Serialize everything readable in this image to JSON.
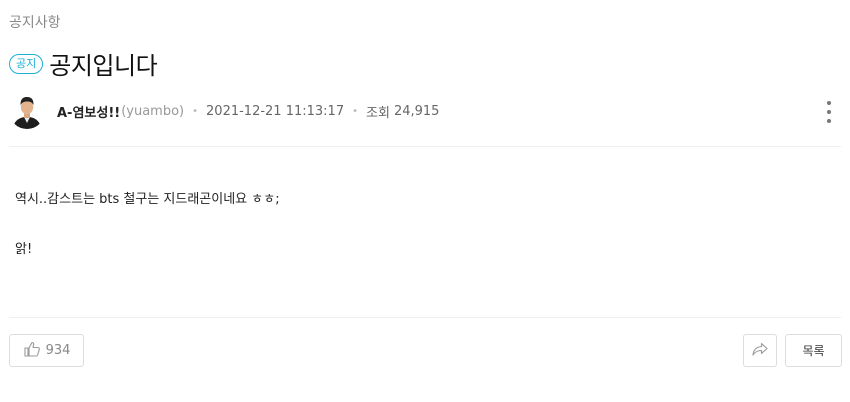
{
  "category": "공지사항",
  "post": {
    "badge": "공지",
    "title": "공지입니다",
    "author": "A-염보성!!",
    "author_id": "(yuambo)",
    "date": "2021-12-21 11:13:17",
    "views_label": "조회",
    "views": "24,915",
    "content": [
      "역시..감스트는 bts 철구는 지드래곤이네요 ㅎㅎ;",
      "앍!"
    ]
  },
  "actions": {
    "like_count": "934",
    "list_label": "목록"
  },
  "icons": {
    "more": "more-vertical-icon",
    "like": "thumbs-up-icon",
    "share": "share-icon"
  },
  "colors": {
    "accent": "#1ab0d6"
  }
}
